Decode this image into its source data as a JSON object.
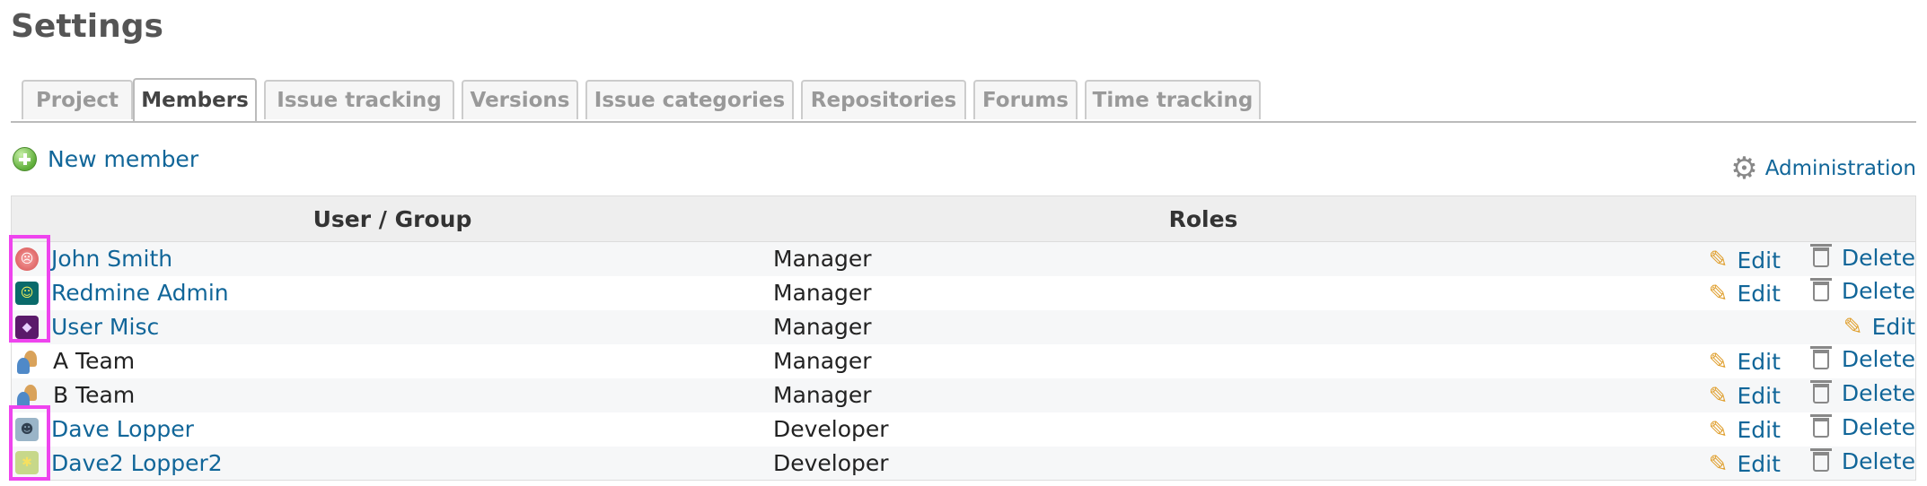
{
  "page": {
    "title": "Settings"
  },
  "tabs": [
    {
      "label": "Project"
    },
    {
      "label": "Members"
    },
    {
      "label": "Issue tracking"
    },
    {
      "label": "Versions"
    },
    {
      "label": "Issue categories"
    },
    {
      "label": "Repositories"
    },
    {
      "label": "Forums"
    },
    {
      "label": "Time tracking"
    }
  ],
  "selected_tab": "Members",
  "new_member": {
    "label": "New member",
    "icon": "plus-circle-icon"
  },
  "administration": {
    "label": "Administration",
    "icon": "gear-icon"
  },
  "table": {
    "headers": {
      "user_group": "User / Group",
      "roles": "Roles"
    },
    "rows": [
      {
        "name": "John Smith",
        "role": "Manager",
        "type": "user",
        "avatar": "red-face-avatar",
        "edit": "Edit",
        "delete": "Delete"
      },
      {
        "name": "Redmine Admin",
        "role": "Manager",
        "type": "user",
        "avatar": "teal-face-avatar",
        "edit": "Edit",
        "delete": "Delete"
      },
      {
        "name": "User Misc",
        "role": "Manager",
        "type": "user",
        "avatar": "purple-diamond-avatar",
        "edit": "Edit"
      },
      {
        "name": "A Team",
        "role": "Manager",
        "type": "group",
        "avatar": "group-icon",
        "edit": "Edit",
        "delete": "Delete"
      },
      {
        "name": "B Team",
        "role": "Manager",
        "type": "group",
        "avatar": "group-icon",
        "edit": "Edit",
        "delete": "Delete"
      },
      {
        "name": "Dave Lopper",
        "role": "Developer",
        "type": "user",
        "avatar": "blue-monster-avatar",
        "edit": "Edit",
        "delete": "Delete"
      },
      {
        "name": "Dave2 Lopper2",
        "role": "Developer",
        "type": "user",
        "avatar": "green-star-avatar",
        "edit": "Edit",
        "delete": "Delete"
      }
    ]
  },
  "colors": {
    "link": "#116699",
    "highlight": "#ee44ee",
    "tab_border": "#bbbbbb"
  }
}
